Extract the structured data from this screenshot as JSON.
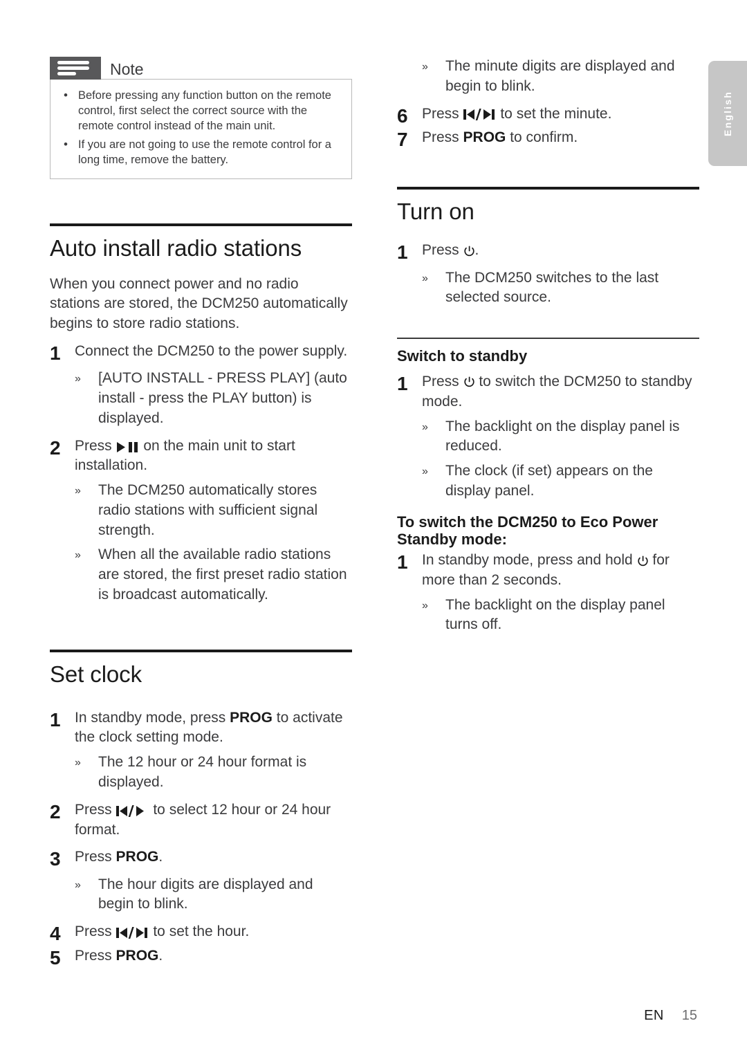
{
  "page": {
    "language_tab": "English",
    "footer": {
      "locale": "EN",
      "page_number": "15"
    }
  },
  "note": {
    "title": "Note",
    "icon": "note-lines-icon",
    "items": [
      "Before pressing any function button on the remote control, first select the correct source with the remote control instead of the main unit.",
      "If you are not going to use the remote control for a long time, remove the battery."
    ]
  },
  "left_column": {
    "sections": [
      {
        "heading": "Auto install radio stations",
        "intro": "When you connect power and no radio stations are stored, the DCM250 automatically begins to store radio stations.",
        "steps": [
          {
            "num": "1",
            "text_before": "Connect the DCM250 to the power supply.",
            "icon": "",
            "text_after": "",
            "results": [
              "[AUTO INSTALL - PRESS PLAY] (auto install - press the PLAY button) is displayed."
            ]
          },
          {
            "num": "2",
            "text_before": "Press ",
            "icon": "play-pause-icon",
            "text_after": " on the main unit to start installation.",
            "results": [
              "The DCM250 automatically stores radio stations with sufficient signal strength.",
              "When all the available radio stations are stored, the first preset radio station is broadcast automatically."
            ]
          }
        ]
      },
      {
        "heading": "Set clock",
        "steps": [
          {
            "num": "1",
            "text_before": "In standby mode, press ",
            "keyword": "PROG",
            "text_after": " to activate the clock setting mode.",
            "results": [
              "The 12 hour or 24 hour format is displayed."
            ]
          },
          {
            "num": "2",
            "text_before": "Press ",
            "icon": "prev-next-icon",
            "text_after": " to select 12 hour or 24 hour format.",
            "results": []
          },
          {
            "num": "3",
            "text_before": "Press ",
            "keyword": "PROG",
            "text_after": ".",
            "results": [
              "The hour digits are displayed and begin to blink."
            ]
          },
          {
            "num": "4",
            "text_before": "Press ",
            "icon": "prev-next-icon",
            "text_after": " to set the hour.",
            "results": []
          },
          {
            "num": "5",
            "text_before": "Press ",
            "keyword": "PROG",
            "text_after": ".",
            "results": []
          }
        ]
      }
    ]
  },
  "right_column": {
    "continued": {
      "lead_result": "The minute digits are displayed and begin to blink.",
      "steps": [
        {
          "num": "6",
          "text_before": "Press ",
          "icon": "prev-next-icon",
          "text_after": " to set the minute."
        },
        {
          "num": "7",
          "text_before": "Press ",
          "keyword": "PROG",
          "text_after": " to confirm."
        }
      ]
    },
    "sections": [
      {
        "heading": "Turn on",
        "heading_level": "h1",
        "steps": [
          {
            "num": "1",
            "text_before": "Press ",
            "icon": "power-icon",
            "text_after": ".",
            "results": [
              "The DCM250 switches to the last selected source."
            ]
          }
        ]
      },
      {
        "heading": "Switch to standby",
        "heading_level": "h2",
        "steps": [
          {
            "num": "1",
            "text_before": "Press ",
            "icon": "power-icon",
            "text_after": " to switch the DCM250 to standby mode.",
            "results": [
              "The backlight on the display panel is reduced.",
              "The clock (if set) appears on the display panel."
            ]
          }
        ],
        "subheading": "To switch the DCM250 to Eco Power Standby mode:",
        "sub_steps": [
          {
            "num": "1",
            "text_before": "In standby mode, press and hold ",
            "icon": "power-icon",
            "text_after": " for more than 2 seconds.",
            "results": [
              "The backlight on the display panel turns off."
            ]
          }
        ]
      }
    ]
  },
  "symbols": {
    "result_marker": "»",
    "bullet": "•"
  },
  "colors": {
    "text": "#3b3b3d",
    "heading": "#1b1b1b",
    "rule": "#1a1a1a",
    "note_tab": "#58585a",
    "note_border": "#b9b9b9",
    "lang_tab": "#c6c6c6",
    "page_number": "#6d6d6f"
  }
}
